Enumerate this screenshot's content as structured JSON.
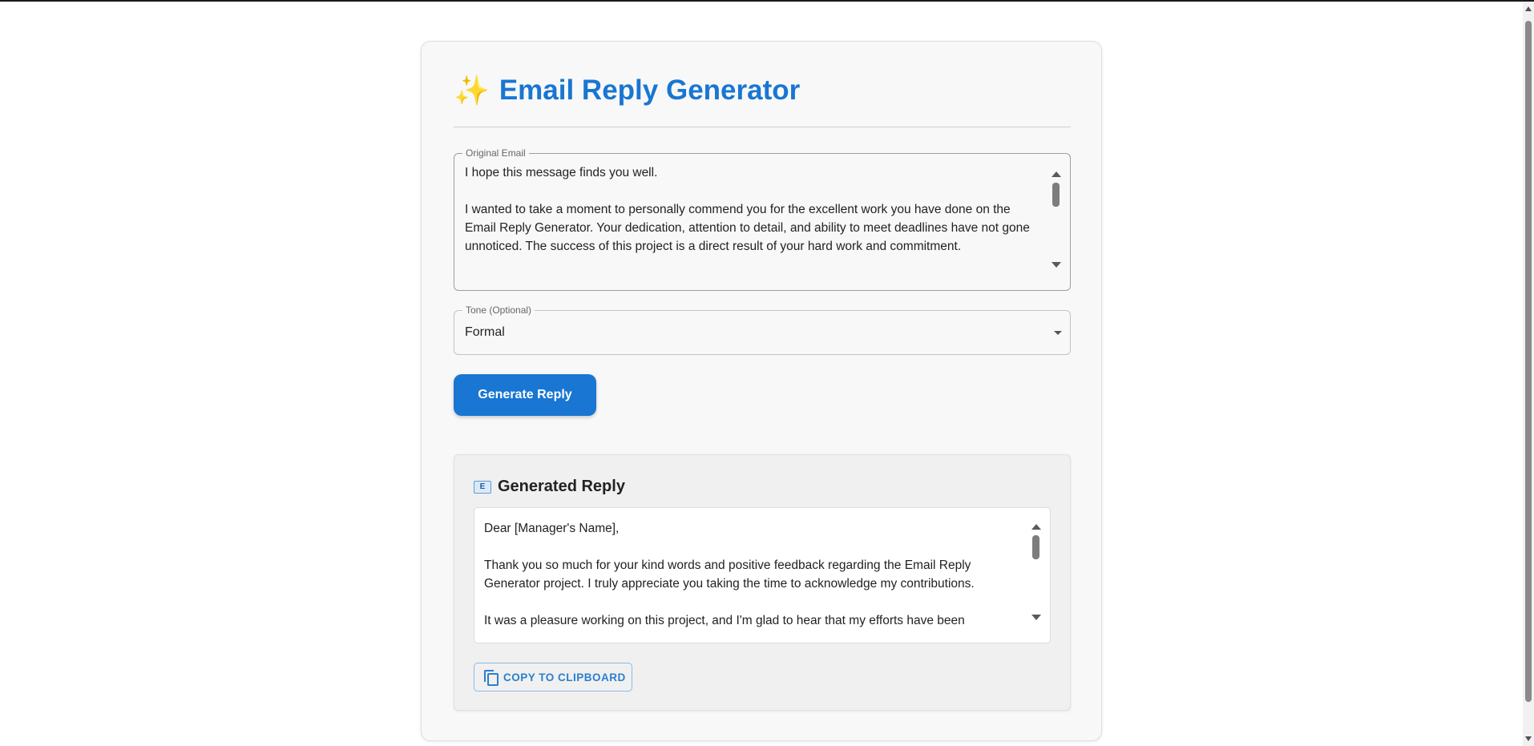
{
  "app": {
    "title_icon": "sparkles-icon",
    "title": "Email Reply Generator"
  },
  "original_email": {
    "label": "Original Email",
    "value": "I hope this message finds you well.\n\nI wanted to take a moment to personally commend you for the excellent work you have done on the Email Reply Generator. Your dedication, attention to detail, and ability to meet deadlines have not gone unnoticed. The success of this project is a direct result of your hard work and commitment."
  },
  "tone": {
    "label": "Tone (Optional)",
    "selected": "Formal"
  },
  "generate_button": {
    "label": "Generate Reply"
  },
  "reply": {
    "icon_text": "E",
    "title": "Generated Reply",
    "value": "Dear [Manager's Name],\n\nThank you so much for your kind words and positive feedback regarding the Email Reply Generator project. I truly appreciate you taking the time to acknowledge my contributions.\n\nIt was a pleasure working on this project, and I'm glad to hear that my efforts have been",
    "copy_label": "COPY TO CLIPBOARD"
  },
  "colors": {
    "accent": "#1976d2",
    "card_background": "#f8f8f8",
    "reply_panel_background": "#f0f0f0"
  }
}
